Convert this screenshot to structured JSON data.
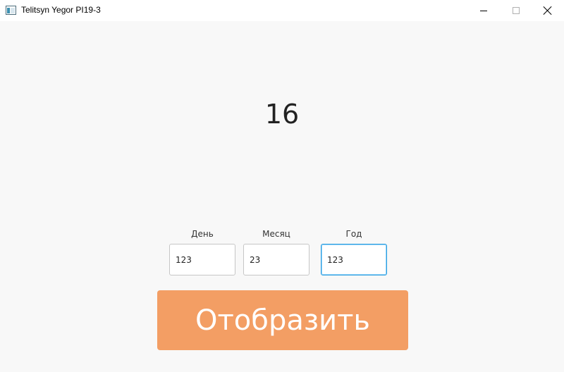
{
  "window": {
    "title": "Telitsyn Yegor PI19-3",
    "icon": "app-window-icon",
    "controls": [
      "minimize-icon",
      "maximize-icon",
      "close-icon"
    ]
  },
  "result": {
    "value": "16"
  },
  "fields": {
    "day": {
      "label": "День",
      "value": "123"
    },
    "month": {
      "label": "Месяц",
      "value": "23"
    },
    "year": {
      "label": "Год",
      "value": "123"
    }
  },
  "actions": {
    "show_label": "Отобразить"
  },
  "colors": {
    "accent_button": "#f39e64",
    "focus_border": "#2f9fe0",
    "background": "#f8f8f8"
  }
}
